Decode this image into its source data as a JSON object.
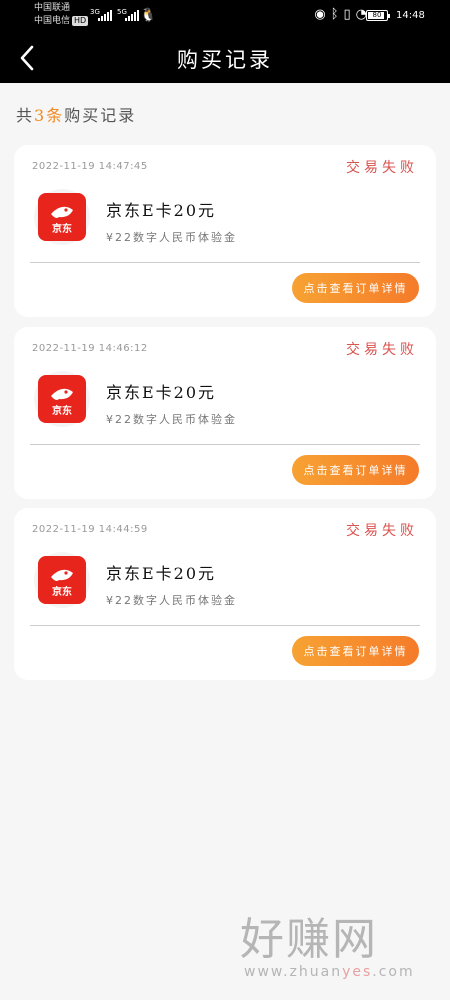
{
  "status_bar": {
    "carrier_1": "中国联通",
    "carrier_2": "中国电信",
    "hd_badge": "HD",
    "net_1": "3G",
    "net_2": "5G",
    "battery": "80",
    "time": "14:48",
    "icons": [
      "eye-icon",
      "bluetooth-icon",
      "vibrate-icon",
      "speed-icon",
      "qq-icon"
    ]
  },
  "nav": {
    "title": "购买记录"
  },
  "summary": {
    "prefix": "共",
    "count": "3条",
    "suffix": "购买记录"
  },
  "records": [
    {
      "time": "2022-11-19 14:47:45",
      "status": "交易失败",
      "product_name": "京东E卡20元",
      "description": "¥22数字人民币体验金",
      "button_label": "点击查看订单详情",
      "logo_text": "京东"
    },
    {
      "time": "2022-11-19 14:46:12",
      "status": "交易失败",
      "product_name": "京东E卡20元",
      "description": "¥22数字人民币体验金",
      "button_label": "点击查看订单详情",
      "logo_text": "京东"
    },
    {
      "time": "2022-11-19 14:44:59",
      "status": "交易失败",
      "product_name": "京东E卡20元",
      "description": "¥22数字人民币体验金",
      "button_label": "点击查看订单详情",
      "logo_text": "京东"
    }
  ],
  "watermark": {
    "logo": "好赚网",
    "url_prefix": "www.zhuan",
    "url_highlight": "yes",
    "url_suffix": ".com"
  },
  "colors": {
    "accent": "#f08a24",
    "status_fail": "#d9534f",
    "button_start": "#f7a233",
    "button_end": "#f57b2a",
    "brand_red": "#e8251d"
  }
}
